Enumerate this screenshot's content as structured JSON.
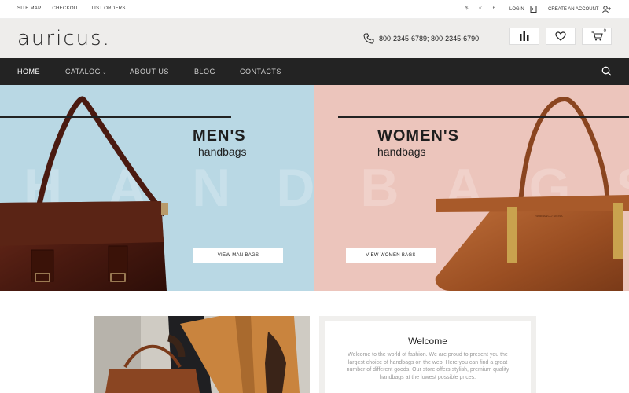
{
  "topbar": {
    "links": [
      "SITE MAP",
      "CHECKOUT",
      "LIST ORDERS"
    ],
    "currencies": [
      "$",
      "€",
      "£"
    ],
    "login_label": "LOGIN",
    "account_label": "CREATE AN ACCOUNT"
  },
  "header": {
    "logo": "auricus.",
    "phone": "800-2345-6789; 800-2345-6790",
    "cart_count": "0"
  },
  "nav": {
    "items": [
      "HOME",
      "CATALOG",
      "ABOUT US",
      "BLOG",
      "CONTACTS"
    ],
    "active": "HOME"
  },
  "hero": {
    "watermark": "HANDBAGS",
    "men": {
      "title": "MEN'S",
      "subtitle": "handbags",
      "button": "VIEW MAN BAGS"
    },
    "women": {
      "title": "WOMEN'S",
      "subtitle": "handbags",
      "button": "VIEW WOMEN BAGS",
      "brand_tag": "RABEANCO SIENA"
    }
  },
  "welcome": {
    "title": "Welcome",
    "text": "Welcome to the world of fashion. We are proud to present you the largest choice of handbags on the web. Here you can find a great number of different goods. Our store offers stylish, premium quality handbags at the lowest possible prices."
  },
  "colors": {
    "nav_bg": "#232323",
    "header_bg": "#eeedeb",
    "men_bg": "#b9d8e4",
    "women_bg": "#ecc5bc"
  }
}
